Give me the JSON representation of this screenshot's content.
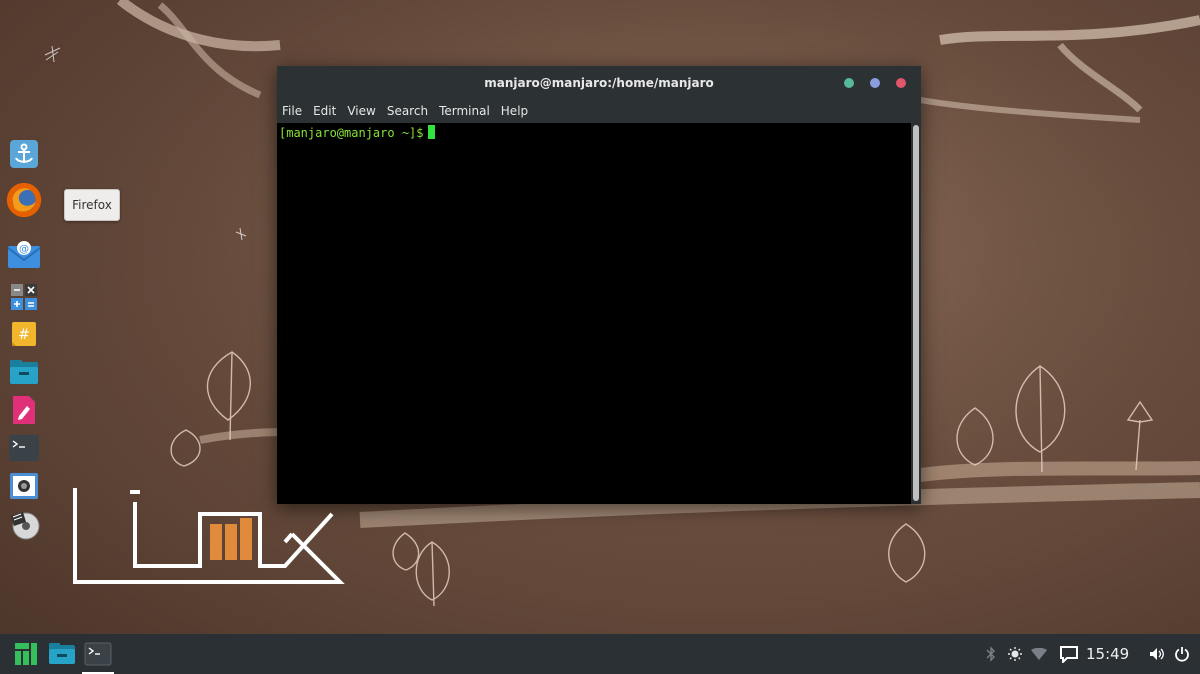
{
  "terminal": {
    "title": "manjaro@manjaro:/home/manjaro",
    "menu": [
      "File",
      "Edit",
      "View",
      "Search",
      "Terminal",
      "Help"
    ],
    "prompt": "[manjaro@manjaro ~]$"
  },
  "dock": {
    "items": [
      {
        "name": "anchor-icon"
      },
      {
        "name": "firefox-icon"
      },
      {
        "name": "mail-icon"
      },
      {
        "name": "calculator-icon"
      },
      {
        "name": "notes-icon"
      },
      {
        "name": "files-icon"
      },
      {
        "name": "text-editor-icon"
      },
      {
        "name": "terminal-icon"
      },
      {
        "name": "screenshot-icon"
      },
      {
        "name": "media-icon"
      }
    ],
    "tooltip": "Firefox"
  },
  "taskbar": {
    "clock": "15:49",
    "launchers": [
      "manjaro-menu-icon",
      "files-icon",
      "terminal-icon"
    ],
    "tray": [
      "bluetooth-icon",
      "brightness-icon",
      "wifi-icon",
      "notification-icon",
      "volume-icon",
      "power-icon"
    ]
  },
  "colors": {
    "prompt": "#8ae234",
    "cursor": "#33e33d",
    "titlebar": "#2c3133",
    "taskbar": "#2b3034",
    "logo_accent": "#e08a3c"
  }
}
